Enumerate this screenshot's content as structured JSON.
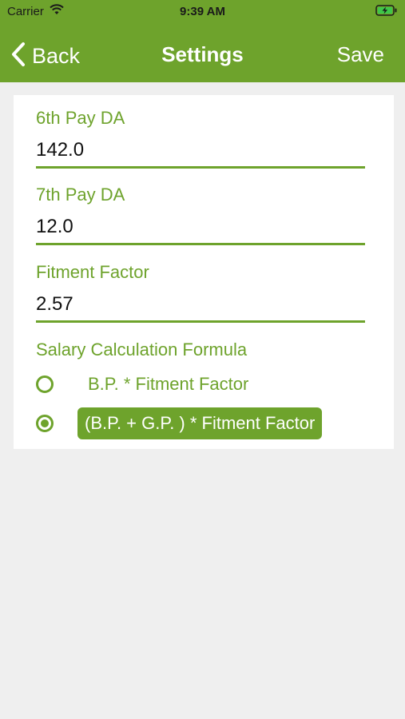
{
  "status_bar": {
    "carrier": "Carrier",
    "time": "9:39 AM"
  },
  "nav": {
    "back_label": "Back",
    "title": "Settings",
    "save_label": "Save"
  },
  "fields": [
    {
      "label": "6th Pay DA",
      "value": "142.0"
    },
    {
      "label": "7th Pay DA",
      "value": "12.0"
    },
    {
      "label": "Fitment Factor",
      "value": "2.57"
    }
  ],
  "formula": {
    "label": "Salary Calculation Formula",
    "options": [
      {
        "label": "B.P. * Fitment Factor",
        "selected": false
      },
      {
        "label": "(B.P. + G.P. ) *  Fitment Factor",
        "selected": true
      }
    ]
  },
  "colors": {
    "accent": "#6ea32c",
    "background": "#efefef",
    "card": "#ffffff"
  },
  "icons": [
    "wifi-icon",
    "battery-charging-icon",
    "chevron-left-icon"
  ]
}
